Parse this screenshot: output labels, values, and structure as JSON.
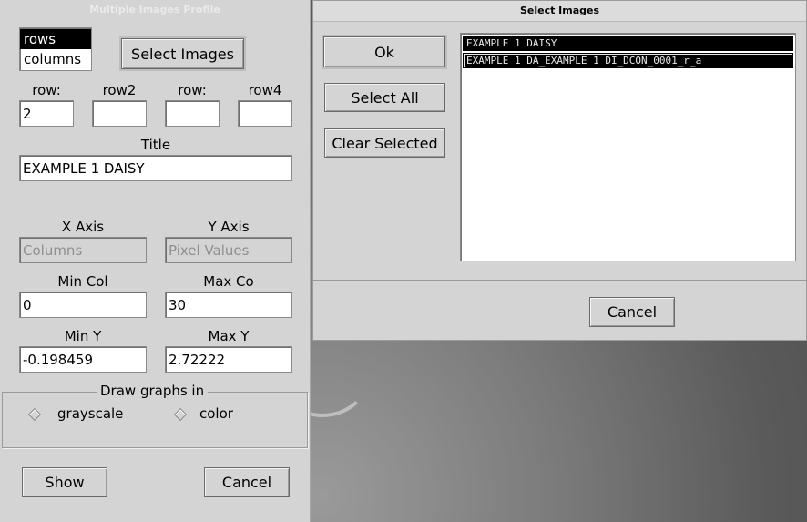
{
  "left_window": {
    "title": "Multiple Images Profile",
    "mode_list": [
      {
        "label": "rows",
        "selected": true
      },
      {
        "label": "columns",
        "selected": false
      }
    ],
    "select_images_label": "Select Images",
    "row_labels": [
      "row:",
      "row2",
      "row:",
      "row4"
    ],
    "row_values": [
      "2",
      "",
      "",
      ""
    ],
    "title_label": "Title",
    "title_value": "EXAMPLE 1 DAISY",
    "x_axis_label": "X Axis",
    "y_axis_label": "Y Axis",
    "x_axis_value": "Columns",
    "y_axis_value": "Pixel Values",
    "min_col_label": "Min Col",
    "max_col_label": "Max Co",
    "min_col_value": "0",
    "max_col_value": "30",
    "min_y_label": "Min Y",
    "max_y_label": "Max Y",
    "min_y_value": "-0.198459",
    "max_y_value": "2.72222",
    "draw_group_label": "Draw graphs in",
    "grayscale_label": "grayscale",
    "color_label": "color",
    "show_label": "Show",
    "cancel_label": "Cancel"
  },
  "right_window": {
    "title": "Select Images",
    "ok_label": "Ok",
    "select_all_label": "Select All",
    "clear_selected_label": "Clear Selected",
    "images": [
      "EXAMPLE 1 DAISY",
      "EXAMPLE 1 DA_EXAMPLE 1 DI_DCON_0001_r_a"
    ],
    "cancel_label": "Cancel"
  }
}
